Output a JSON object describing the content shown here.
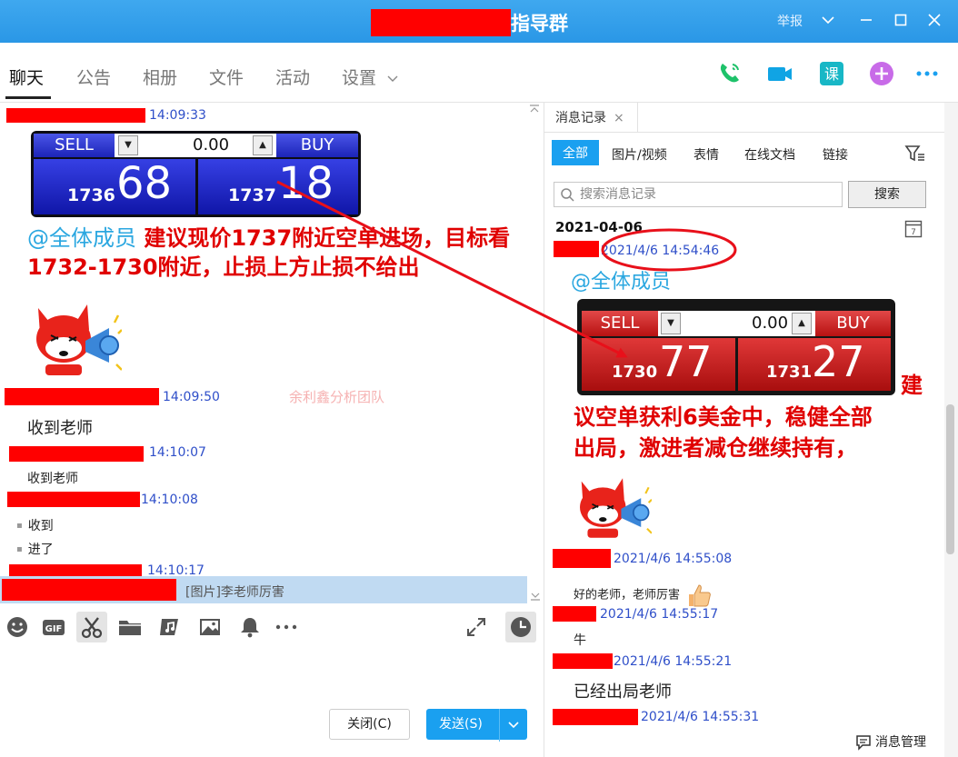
{
  "window": {
    "group_name": "指导群",
    "report": "举报"
  },
  "tabs": [
    "聊天",
    "公告",
    "相册",
    "文件",
    "活动",
    "设置"
  ],
  "chat": {
    "messages": [
      {
        "time": "14:09:33"
      },
      {
        "time": "14:09:50",
        "text": "收到老师"
      },
      {
        "time": "14:10:07",
        "text": "收到老师"
      },
      {
        "time": "14:10:08",
        "lines": [
          "收到",
          "进了"
        ]
      },
      {
        "time": "14:10:17"
      }
    ],
    "mention": "@全体成员",
    "instruction": "建议现价1737附近空单进场，目标看1732-1730附近，止损上方止损不给出",
    "watermark": "余利鑫分析团队",
    "quote": "[图片]李老师厉害",
    "widget": {
      "sell_label": "SELL",
      "buy_label": "BUY",
      "lot_value": "0.00",
      "sell_prefix": "1736",
      "sell_big": "68",
      "buy_prefix": "1737",
      "buy_big": "18"
    }
  },
  "composer": {
    "close_label": "关闭(C)",
    "send_label": "发送(S)"
  },
  "history": {
    "tab_label": "消息记录",
    "filters": [
      "全部",
      "图片/视频",
      "表情",
      "在线文档",
      "链接"
    ],
    "search_placeholder": "搜索消息记录",
    "search_button": "搜索",
    "date_header": "2021-04-06",
    "messages": [
      {
        "time": "2021/4/6 14:54:46"
      },
      {
        "time": "2021/4/6 14:55:08",
        "text": "好的老师，老师厉害"
      },
      {
        "time": "2021/4/6 14:55:17",
        "text": "牛"
      },
      {
        "time": "2021/4/6 14:55:21",
        "text": "已经出局老师"
      },
      {
        "time": "2021/4/6 14:55:31"
      }
    ],
    "mention": "@全体成员",
    "instruction_line1": "建",
    "instruction_line2": "议空单获利6美金中，稳健全部",
    "instruction_line3": "出局，激进者减仓继续持有，",
    "widget": {
      "sell_label": "SELL",
      "buy_label": "BUY",
      "lot_value": "0.00",
      "sell_prefix": "1730",
      "sell_big": "77",
      "buy_prefix": "1731",
      "buy_big": "27"
    },
    "footer_label": "消息管理"
  },
  "colors": {
    "accent": "#1aa0f0",
    "title_bar": "#2a97e6",
    "redaction": "#ff0000",
    "instruction_text": "#e00000",
    "timestamp": "#2f4fc9",
    "annotation_arrow": "#e8101a",
    "widget_blue": "#1d24c8",
    "widget_red": "#c41414"
  },
  "icons": [
    "phone-icon",
    "video-icon",
    "course-icon",
    "add-app-icon",
    "more-icon",
    "emoji-icon",
    "gif-icon",
    "screenshot-scissors-icon",
    "folder-icon",
    "music-icon",
    "image-icon",
    "bell-icon",
    "expand-icon",
    "history-clock-icon",
    "calendar-icon",
    "filter-icon",
    "search-icon",
    "message-manage-icon"
  ]
}
